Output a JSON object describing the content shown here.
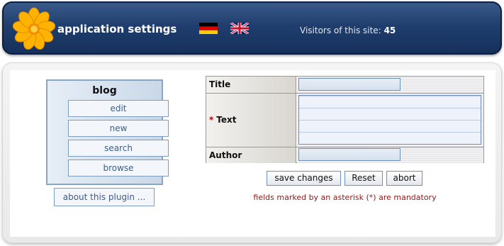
{
  "header": {
    "title": "application settings",
    "visitors_label": "Visitors of this site:",
    "visitors_count": "45",
    "languages": [
      {
        "name": "german-flag-icon",
        "lang": "de"
      },
      {
        "name": "english-flag-icon",
        "lang": "en"
      }
    ],
    "logo_icon": "flower-icon"
  },
  "sidebar": {
    "title": "blog",
    "items": [
      {
        "label": "edit"
      },
      {
        "label": "new"
      },
      {
        "label": "search"
      },
      {
        "label": "browse"
      }
    ],
    "about_label": "about this plugin ..."
  },
  "form": {
    "fields": [
      {
        "label": "Title",
        "required": false,
        "value": ""
      },
      {
        "label": "Text",
        "required": true,
        "value": ""
      },
      {
        "label": "Author",
        "required": false,
        "value": ""
      }
    ],
    "required_marker": "*",
    "buttons": {
      "save": "save changes",
      "reset": "Reset",
      "abort": "abort"
    },
    "note": "fields marked by an asterisk (*) are mandatory"
  },
  "colors": {
    "header_bg": "#1f3e6e",
    "nav_text": "#3d5d88",
    "note_text": "#8b1a1a",
    "required": "#c00000"
  }
}
